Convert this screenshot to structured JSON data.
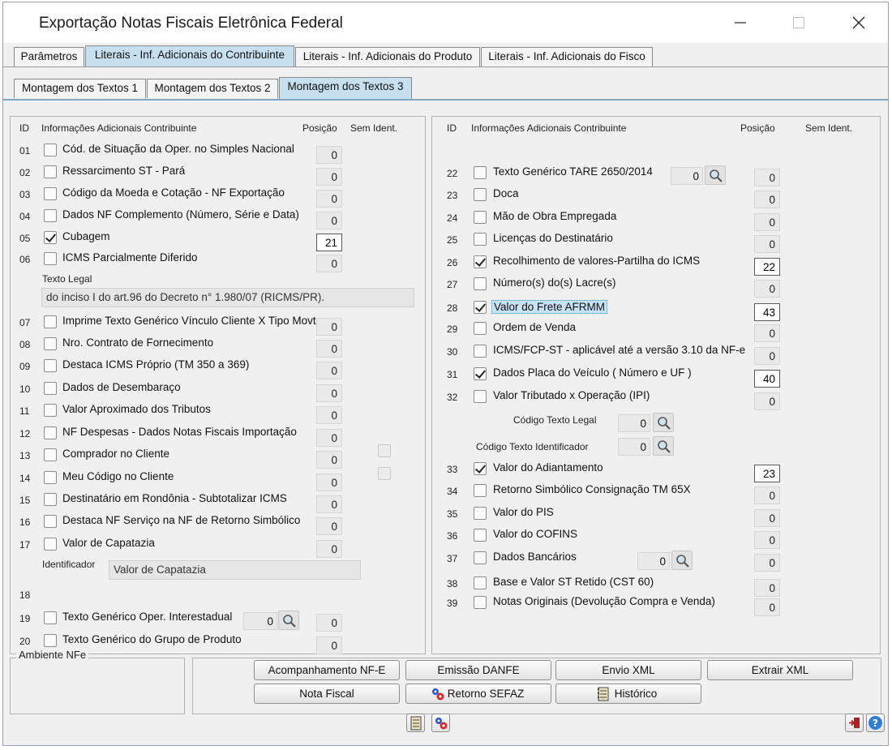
{
  "window": {
    "title": "Exportação Notas Fiscais Eletrônica Federal"
  },
  "tabs": [
    "Parâmetros",
    "Literais - Inf. Adicionais do Contribuinte",
    "Literais - Inf. Adicionais do Produto",
    "Literais - Inf. Adicionais do Fisco"
  ],
  "subtabs": [
    "Montagem dos Textos 1",
    "Montagem dos Textos 2",
    "Montagem dos Textos 3"
  ],
  "left": {
    "hdr_id": "ID",
    "hdr_info": "Informações Adicionais Contribuinte",
    "hdr_pos": "Posição",
    "hdr_sem": "Sem Ident.",
    "rows": [
      {
        "id": "01",
        "label": "Cód. de Situação da Oper. no Simples Nacional",
        "checked": false,
        "pos": "0"
      },
      {
        "id": "02",
        "label": "Ressarcimento ST - Pará",
        "checked": false,
        "pos": "0"
      },
      {
        "id": "03",
        "label": "Código da Moeda e Cotação - NF Exportação",
        "checked": false,
        "pos": "0"
      },
      {
        "id": "04",
        "label": "Dados NF Complemento (Número, Série e Data)",
        "checked": false,
        "pos": "0"
      },
      {
        "id": "05",
        "label": "Cubagem",
        "checked": true,
        "pos": "21"
      },
      {
        "id": "06",
        "label": "ICMS Parcialmente Diferido",
        "checked": false,
        "pos": "0"
      },
      {
        "id": "07",
        "label": "Imprime Texto Genérico Vínculo Cliente X Tipo Movto",
        "checked": false,
        "pos": "0"
      },
      {
        "id": "08",
        "label": "Nro. Contrato de Fornecimento",
        "checked": false,
        "pos": "0"
      },
      {
        "id": "09",
        "label": "Destaca ICMS Próprio  (TM 350 a 369)",
        "checked": false,
        "pos": "0"
      },
      {
        "id": "10",
        "label": "Dados de Desembaraço",
        "checked": false,
        "pos": "0"
      },
      {
        "id": "11",
        "label": "Valor Aproximado dos Tributos",
        "checked": false,
        "pos": "0"
      },
      {
        "id": "12",
        "label": "NF Despesas - Dados Notas Fiscais Importação",
        "checked": false,
        "pos": "0"
      },
      {
        "id": "13",
        "label": "Comprador no Cliente",
        "checked": false,
        "pos": "0"
      },
      {
        "id": "14",
        "label": "Meu Código no Cliente",
        "checked": false,
        "pos": "0"
      },
      {
        "id": "15",
        "label": "Destinatário em Rondônia - Subtotalizar ICMS",
        "checked": false,
        "pos": "0"
      },
      {
        "id": "16",
        "label": "Destaca NF Serviço na NF de Retorno Simbólico",
        "checked": false,
        "pos": "0"
      },
      {
        "id": "17",
        "label": "Valor de Capatazia",
        "checked": false,
        "pos": "0"
      },
      {
        "id": "19",
        "label": "Texto Genérico Oper. Interestadual",
        "checked": false,
        "pos": "0",
        "code": "0"
      },
      {
        "id": "20",
        "label": "Texto Genérico do Grupo de Produto",
        "checked": false,
        "pos": "0"
      }
    ],
    "texto_legal_label": "Texto Legal",
    "texto_legal_value": "do inciso I do art.96 do Decreto n° 1.980/07 (RICMS/PR).",
    "identificador_label": "Identificador",
    "identificador_value": "Valor de Capatazia",
    "id18": "18",
    "ambiente_label": "Ambiente NFe"
  },
  "right": {
    "hdr_id": "ID",
    "hdr_info": "Informações Adicionais Contribuinte",
    "hdr_pos": "Posição",
    "hdr_sem": "Sem Ident.",
    "rows": [
      {
        "id": "22",
        "label": "Texto Genérico TARE 2650/2014",
        "checked": false,
        "pos": "0",
        "code": "0"
      },
      {
        "id": "23",
        "label": "Doca",
        "checked": false,
        "pos": "0"
      },
      {
        "id": "24",
        "label": "Mão de Obra Empregada",
        "checked": false,
        "pos": "0"
      },
      {
        "id": "25",
        "label": "Licenças do Destinatário",
        "checked": false,
        "pos": "0"
      },
      {
        "id": "26",
        "label": "Recolhimento de valores-Partilha do ICMS",
        "checked": true,
        "pos": "22"
      },
      {
        "id": "27",
        "label": "Número(s) do(s) Lacre(s)",
        "checked": false,
        "pos": "0"
      },
      {
        "id": "28",
        "label": "Valor do Frete AFRMM",
        "checked": true,
        "pos": "43"
      },
      {
        "id": "29",
        "label": "Ordem de Venda",
        "checked": false,
        "pos": "0"
      },
      {
        "id": "30",
        "label": "ICMS/FCP-ST - aplicável até a versão 3.10 da NF-e",
        "checked": false,
        "pos": "0"
      },
      {
        "id": "31",
        "label": "Dados Placa do Veículo ( Número e UF )",
        "checked": true,
        "pos": "40"
      },
      {
        "id": "32",
        "label": "Valor Tributado x Operação (IPI)",
        "checked": false,
        "pos": "0"
      },
      {
        "id": "33",
        "label": "Valor do Adiantamento",
        "checked": true,
        "pos": "23"
      },
      {
        "id": "34",
        "label": "Retorno Simbólico Consignação TM 65X",
        "checked": false,
        "pos": "0"
      },
      {
        "id": "35",
        "label": "Valor do PIS",
        "checked": false,
        "pos": "0"
      },
      {
        "id": "36",
        "label": "Valor do COFINS",
        "checked": false,
        "pos": "0"
      },
      {
        "id": "37",
        "label": "Dados Bancários",
        "checked": false,
        "pos": "0",
        "code": "0"
      },
      {
        "id": "38",
        "label": "Base e Valor ST Retido (CST 60)",
        "checked": false,
        "pos": "0"
      },
      {
        "id": "39",
        "label": "Notas Originais (Devolução Compra e Venda)",
        "checked": false,
        "pos": "0"
      }
    ],
    "codigo_texto_legal_label": "Código Texto Legal",
    "codigo_texto_legal_value": "0",
    "codigo_texto_ident_label": "Código Texto Identificador",
    "codigo_texto_ident_value": "0"
  },
  "buttons": {
    "acompanhamento": "Acompanhamento NF-E",
    "emissao": "Emissão DANFE",
    "envio": "Envio XML",
    "extrair": "Extrair XML",
    "nota_fiscal": "Nota Fiscal",
    "retorno": "Retorno SEFAZ",
    "historico": "Histórico"
  },
  "icons": {
    "minimize": "minimize-icon",
    "maximize": "maximize-icon",
    "close": "close-icon",
    "search": "magnifier-icon",
    "gears": "gears-icon",
    "notebook": "notebook-icon",
    "exit": "exit-door-icon",
    "help": "help-icon"
  },
  "colors": {
    "active_tab": "#c6e0ef",
    "highlight": "#c8e3f7"
  }
}
